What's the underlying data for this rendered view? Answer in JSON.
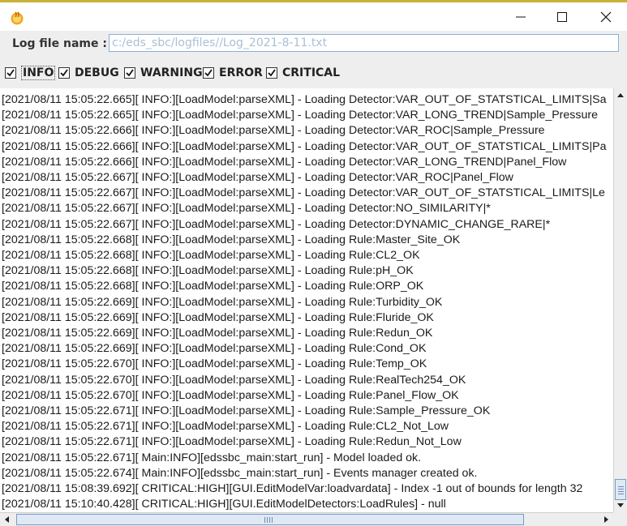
{
  "window": {
    "icon": "java-cup-icon",
    "controls": [
      "minimize-icon",
      "maximize-icon",
      "close-icon"
    ]
  },
  "log_file": {
    "label": "Log file name :",
    "value": "c:/eds_sbc/logfiles//Log_2021-8-11.txt"
  },
  "filters": [
    {
      "label": "INFO",
      "checked": true
    },
    {
      "label": "DEBUG",
      "checked": true
    },
    {
      "label": "WARNING",
      "checked": true
    },
    {
      "label": "ERROR",
      "checked": true
    },
    {
      "label": "CRITICAL",
      "checked": true
    }
  ],
  "log_lines": [
    "[2021/08/11 15:05:22.665][ INFO:][LoadModel:parseXML] - Loading Detector:VAR_OUT_OF_STATSTICAL_LIMITS|Sa",
    "[2021/08/11 15:05:22.665][ INFO:][LoadModel:parseXML] - Loading Detector:VAR_LONG_TREND|Sample_Pressure",
    "[2021/08/11 15:05:22.666][ INFO:][LoadModel:parseXML] - Loading Detector:VAR_ROC|Sample_Pressure",
    "[2021/08/11 15:05:22.666][ INFO:][LoadModel:parseXML] - Loading Detector:VAR_OUT_OF_STATSTICAL_LIMITS|Pa",
    "[2021/08/11 15:05:22.666][ INFO:][LoadModel:parseXML] - Loading Detector:VAR_LONG_TREND|Panel_Flow",
    "[2021/08/11 15:05:22.667][ INFO:][LoadModel:parseXML] - Loading Detector:VAR_ROC|Panel_Flow",
    "[2021/08/11 15:05:22.667][ INFO:][LoadModel:parseXML] - Loading Detector:VAR_OUT_OF_STATSTICAL_LIMITS|Le",
    "[2021/08/11 15:05:22.667][ INFO:][LoadModel:parseXML] - Loading Detector:NO_SIMILARITY|*",
    "[2021/08/11 15:05:22.667][ INFO:][LoadModel:parseXML] - Loading Detector:DYNAMIC_CHANGE_RARE|*",
    "[2021/08/11 15:05:22.668][ INFO:][LoadModel:parseXML] - Loading Rule:Master_Site_OK",
    "[2021/08/11 15:05:22.668][ INFO:][LoadModel:parseXML] - Loading Rule:CL2_OK",
    "[2021/08/11 15:05:22.668][ INFO:][LoadModel:parseXML] - Loading Rule:pH_OK",
    "[2021/08/11 15:05:22.668][ INFO:][LoadModel:parseXML] - Loading Rule:ORP_OK",
    "[2021/08/11 15:05:22.669][ INFO:][LoadModel:parseXML] - Loading Rule:Turbidity_OK",
    "[2021/08/11 15:05:22.669][ INFO:][LoadModel:parseXML] - Loading Rule:Fluride_OK",
    "[2021/08/11 15:05:22.669][ INFO:][LoadModel:parseXML] - Loading Rule:Redun_OK",
    "[2021/08/11 15:05:22.669][ INFO:][LoadModel:parseXML] - Loading Rule:Cond_OK",
    "[2021/08/11 15:05:22.670][ INFO:][LoadModel:parseXML] - Loading Rule:Temp_OK",
    "[2021/08/11 15:05:22.670][ INFO:][LoadModel:parseXML] - Loading Rule:RealTech254_OK",
    "[2021/08/11 15:05:22.670][ INFO:][LoadModel:parseXML] - Loading Rule:Panel_Flow_OK",
    "[2021/08/11 15:05:22.671][ INFO:][LoadModel:parseXML] - Loading Rule:Sample_Pressure_OK",
    "[2021/08/11 15:05:22.671][ INFO:][LoadModel:parseXML] - Loading Rule:CL2_Not_Low",
    "[2021/08/11 15:05:22.671][ INFO:][LoadModel:parseXML] - Loading Rule:Redun_Not_Low",
    "[2021/08/11 15:05:22.671][ Main:INFO][edssbc_main:start_run] - Model loaded ok.",
    "[2021/08/11 15:05:22.674][ Main:INFO][edssbc_main:start_run] - Events manager created ok.",
    "[2021/08/11 15:08:39.692][ CRITICAL:HIGH][GUI.EditModelVar:loadvardata] - Index -1 out of bounds for length 32",
    "[2021/08/11 15:10:40.428][ CRITICAL:HIGH][GUI.EditModelDetectors:LoadRules] - null"
  ]
}
